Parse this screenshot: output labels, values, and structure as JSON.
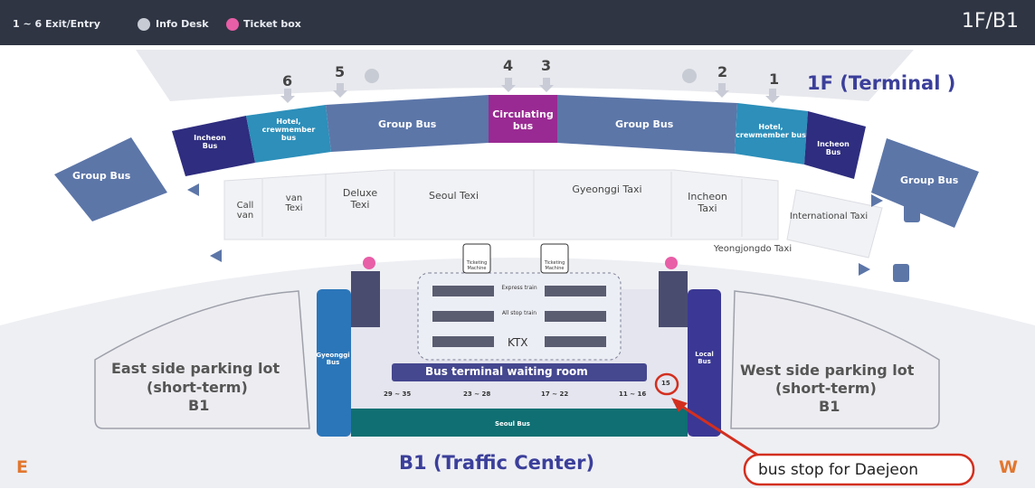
{
  "header": {
    "legend_exit": "1 ~ 6 Exit/Entry",
    "legend_info": "Info Desk",
    "legend_ticket": "Ticket box",
    "floor": "1F/B1"
  },
  "level_1f": {
    "title": "1F (Terminal )",
    "exit_numbers": [
      "6",
      "5",
      "4",
      "3",
      "2",
      "1"
    ],
    "bus_zones": [
      "Group Bus",
      "Incheon Bus",
      "Hotel, crewmember bus",
      "Group Bus",
      "Circulating bus",
      "Group Bus",
      "Hotel, crewmember bus",
      "Incheon Bus",
      "Group Bus"
    ],
    "taxi_zones": [
      "Call van",
      "van Texi",
      "Deluxe Texi",
      "Seoul Texi",
      "Gyeonggi Taxi",
      "Incheon Taxi",
      "International Taxi",
      "Yeongjongdo Taxi"
    ]
  },
  "level_b1": {
    "title": "B1 (Traffic Center)",
    "east_parking": [
      "East side parking lot",
      "(short-term)",
      "B1"
    ],
    "west_parking": [
      "West side parking lot",
      "(short-term)",
      "B1"
    ],
    "train_lines": [
      "Express train",
      "All stop train",
      "KTX"
    ],
    "ticket_machine": "Ticketing Machine",
    "waiting_room": "Bus terminal waiting room",
    "gyeonggi_bus": "Gyeonggi Bus",
    "local_bus": "Local Bus",
    "seoul_bus": "Seoul Bus",
    "platforms": [
      "29 ~ 35",
      "23 ~ 28",
      "17 ~ 22",
      "11 ~ 16"
    ],
    "stop_number": "15"
  },
  "compass": {
    "east": "E",
    "west": "W"
  },
  "callout": "bus stop for Daejeon",
  "colors": {
    "top_bar": "#2f3543",
    "group_bus": "#5c76a8",
    "incheon_bus": "#2e2d7f",
    "hotel_bus": "#2d8fba",
    "circulating_bus": "#9a2a93",
    "seoul_bus": "#0f6f72",
    "gyeonggi_bus": "#2b76b9",
    "local_bus": "#3a3894",
    "title_blue": "#3b3f9a",
    "callout_red": "#d32f1f",
    "compass_orange": "#e2772f"
  }
}
